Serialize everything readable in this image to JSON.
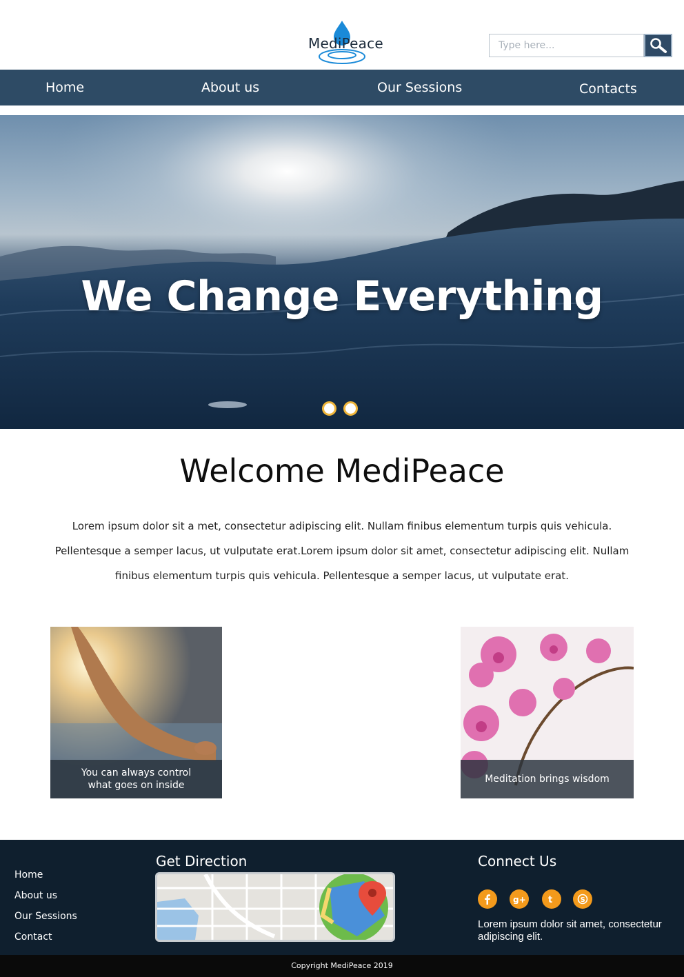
{
  "header": {
    "logo_text": "MediPeace",
    "search_placeholder": "Type here..."
  },
  "nav": {
    "items": [
      {
        "label": "Home"
      },
      {
        "label": "About us"
      },
      {
        "label": "Our Sessions"
      },
      {
        "label": "Contacts"
      }
    ]
  },
  "hero": {
    "title": "We Change Everything",
    "slide_count": 2
  },
  "welcome": {
    "title": "Welcome MediPeace",
    "paragraph": "Lorem ipsum dolor sit a met, consectetur adipiscing elit. Nullam finibus elementum turpis quis vehicula. Pellentesque a semper lacus, ut vulputate erat.Lorem ipsum dolor sit amet, consectetur adipiscing elit. Nullam finibus elementum turpis quis vehicula. Pellentesque a semper lacus, ut vulputate erat."
  },
  "cards": [
    {
      "caption": "You can always control what goes on inside"
    },
    {
      "caption": "Meditation brings wisdom"
    }
  ],
  "footer": {
    "links": [
      {
        "label": "Home"
      },
      {
        "label": "About us"
      },
      {
        "label": "Our Sessions"
      },
      {
        "label": "Contact"
      }
    ],
    "direction_heading": "Get Direction",
    "connect_heading": "Connect Us",
    "social_icons": [
      "facebook-icon",
      "google-plus-icon",
      "twitter-icon",
      "skype-icon"
    ],
    "connect_text": "Lorem ipsum dolor sit amet, consectetur adipiscing elit.",
    "copyright": "Copyright MediPeace 2019"
  },
  "colors": {
    "nav_bg": "#2e4b65",
    "footer_bg": "#0f1f2e",
    "accent_orange": "#f39a1c",
    "dot_border": "#f0b63a",
    "logo_blue": "#1a8ad8"
  }
}
